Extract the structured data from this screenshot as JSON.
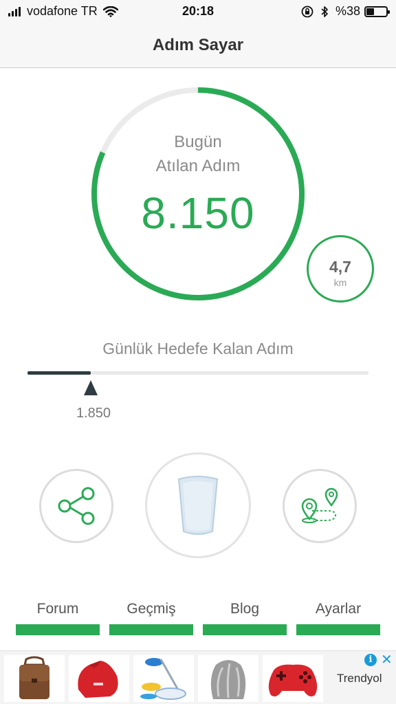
{
  "status_bar": {
    "carrier": "vodafone TR",
    "time": "20:18",
    "battery_text": "%38",
    "battery_level": 0.38
  },
  "nav": {
    "title": "Adım Sayar"
  },
  "today": {
    "label_line1": "Bugün",
    "label_line2": "Atılan Adım",
    "steps": "8.150",
    "goal_progress": 0.815
  },
  "distance": {
    "value": "4,7",
    "unit": "km"
  },
  "goal": {
    "label": "Günlük Hedefe Kalan Adım",
    "remaining": "1.850",
    "progress": 0.185
  },
  "menu": [
    {
      "label": "Forum"
    },
    {
      "label": "Geçmiş"
    },
    {
      "label": "Blog"
    },
    {
      "label": "Ayarlar"
    }
  ],
  "ad": {
    "brand": "Trendyol",
    "products": [
      "bag",
      "camera-case",
      "spin-mop",
      "fur-item",
      "game-controller"
    ]
  },
  "colors": {
    "accent": "#2aaa55",
    "ring_track": "#ebebeb",
    "progress_dark": "#2f3d42",
    "bar_bg": "#f7f7f7"
  },
  "icons": {
    "share": "share-icon",
    "cup": "water-cup-icon",
    "route": "route-map-icon",
    "wifi": "wifi-icon",
    "lock": "orientation-lock-icon",
    "bluetooth": "bluetooth-icon"
  }
}
